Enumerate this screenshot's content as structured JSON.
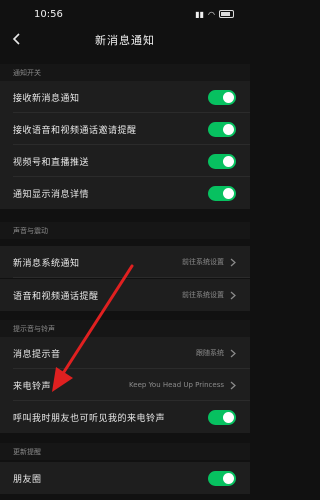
{
  "status_bar": {
    "time": "10:56"
  },
  "nav": {
    "title": "新消息通知"
  },
  "sections": {
    "notify_switch": "通知开关",
    "sound_vibration": "声音与震动",
    "ringtone": "提示音与铃声",
    "more": "更新提醒"
  },
  "rows": {
    "receive_new": "接收新消息通知",
    "receive_voice_video": "接收语音和视频通话邀请提醒",
    "channels_live": "视频号和直播推送",
    "show_detail": "通知显示消息详情",
    "msg_system_notify": "新消息系统通知",
    "msg_system_notify_value": "前往系统设置",
    "voice_video_notify": "语音和视频通话提醒",
    "voice_video_notify_value": "前往系统设置",
    "msg_tone": "消息提示音",
    "msg_tone_value": "跟随系统",
    "ringtone": "来电铃声",
    "ringtone_value": "Keep You Head Up Princess",
    "friends_hear": "呼叫我时朋友也可听见我的来电铃声",
    "moments": "朋友圈"
  },
  "colors": {
    "toggle_on": "#07c160",
    "arrow": "#e02020"
  },
  "icons": {
    "back": "chevron-left-icon",
    "row_chevron": "chevron-right-icon"
  }
}
